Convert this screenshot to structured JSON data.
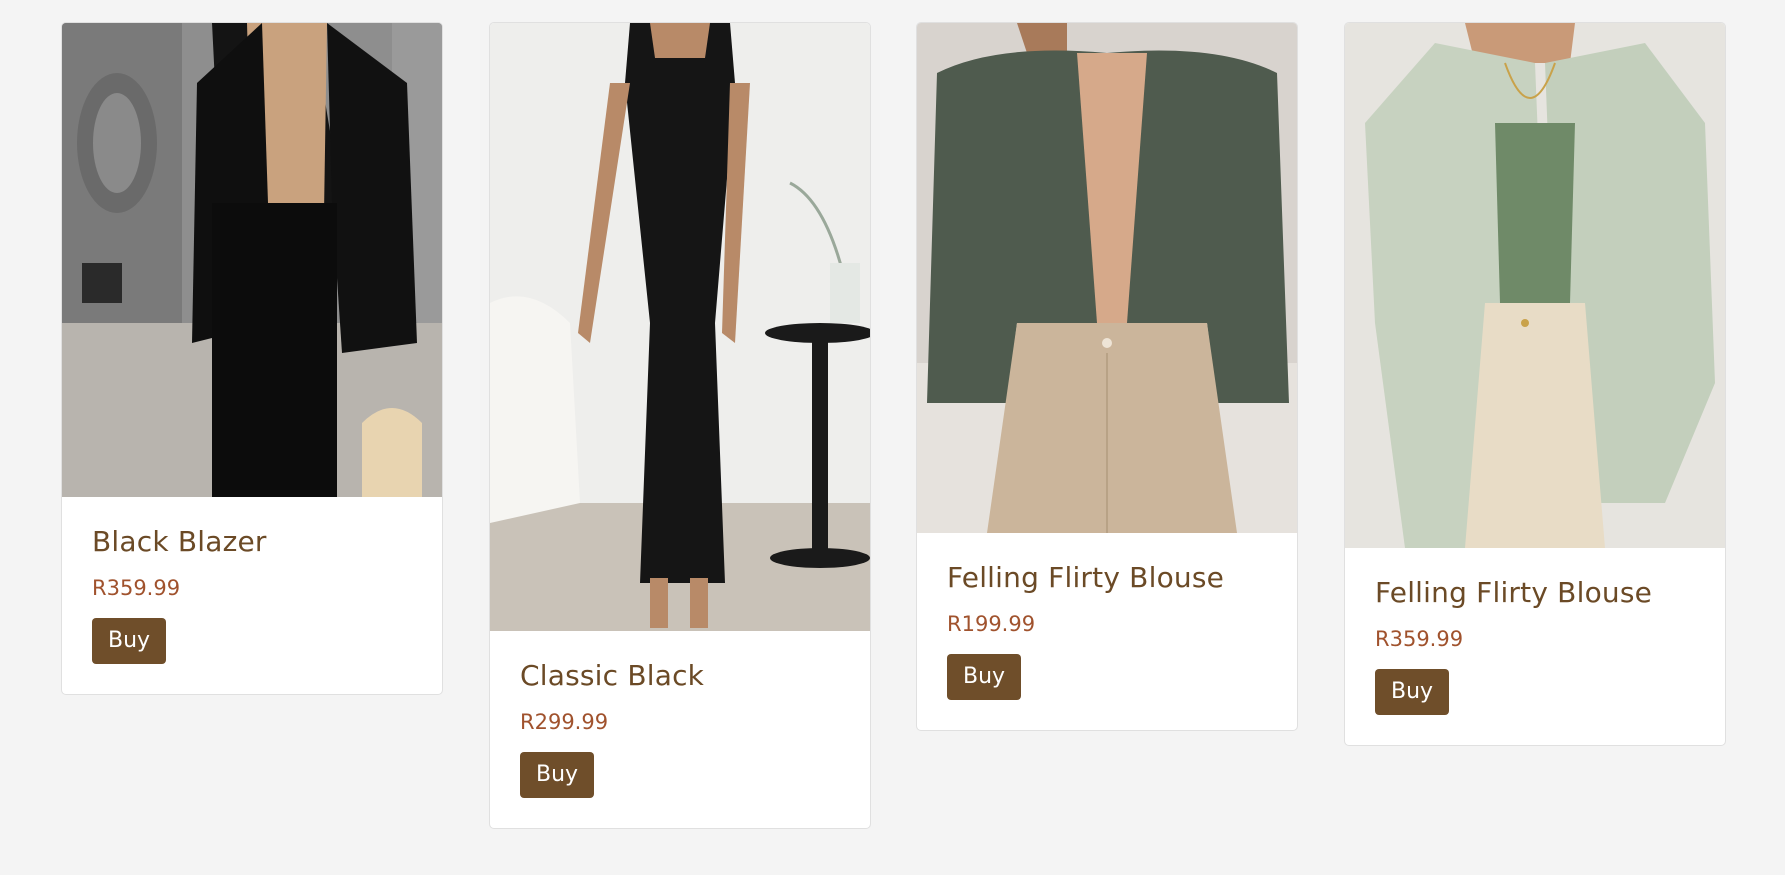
{
  "products": [
    {
      "title": "Black Blazer",
      "price": "R359.99",
      "button_label": "Buy"
    },
    {
      "title": "Classic Black",
      "price": "R299.99",
      "button_label": "Buy"
    },
    {
      "title": "Felling Flirty Blouse",
      "price": "R199.99",
      "button_label": "Buy"
    },
    {
      "title": "Felling Flirty Blouse",
      "price": "R359.99",
      "button_label": "Buy"
    }
  ],
  "colors": {
    "page_background": "#f4f4f4",
    "title": "#6b4a26",
    "price": "#a0522d",
    "button_background": "#6f4e2a",
    "button_text": "#ffffff"
  }
}
